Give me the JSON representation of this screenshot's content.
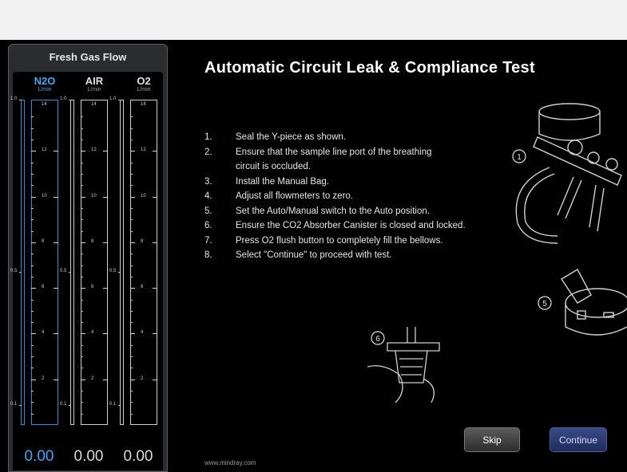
{
  "fresh_gas_flow": {
    "title": "Fresh Gas Flow",
    "columns": [
      {
        "name": "N2O",
        "unit": "L/min",
        "value": "0.00",
        "active": true
      },
      {
        "name": "AIR",
        "unit": "L/min",
        "value": "0.00",
        "active": false
      },
      {
        "name": "O2",
        "unit": "L/min",
        "value": "0.00",
        "active": false
      }
    ],
    "scale_labels": [
      "14",
      "12",
      "10",
      "8",
      "6",
      "4",
      "2"
    ],
    "side_labels": [
      "1.0",
      "0.5",
      "0.1"
    ]
  },
  "test": {
    "title": "Automatic Circuit Leak & Compliance Test",
    "steps": [
      {
        "num": "1.",
        "text": "Seal the Y-piece as shown."
      },
      {
        "num": "2.",
        "text": "Ensure that the sample line port of the breathing"
      },
      {
        "num": "",
        "text": "circuit is occluded."
      },
      {
        "num": "3.",
        "text": "Install the Manual Bag."
      },
      {
        "num": "4.",
        "text": "Adjust all flowmeters to zero."
      },
      {
        "num": "5.",
        "text": "Set the Auto/Manual switch to the Auto position."
      },
      {
        "num": "6.",
        "text": "Ensure the CO2 Absorber Canister is closed and locked."
      },
      {
        "num": "7.",
        "text": "Press O2 flush button to completely fill the bellows."
      },
      {
        "num": "8.",
        "text": "Select \"Continue\" to proceed with test."
      }
    ],
    "callouts": {
      "one": "1",
      "five": "5",
      "six": "6"
    }
  },
  "buttons": {
    "skip": "Skip",
    "continue": "Continue"
  },
  "footer": "www.mindray.com"
}
